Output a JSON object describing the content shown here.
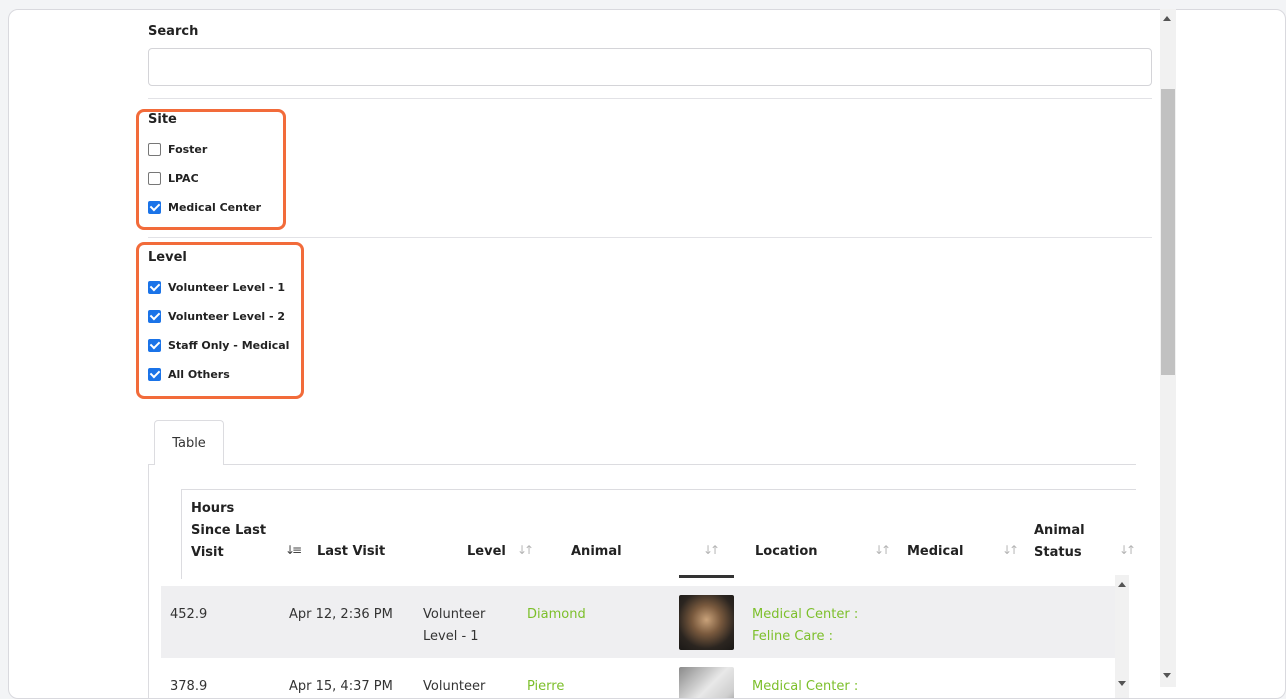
{
  "search": {
    "label": "Search",
    "value": "",
    "placeholder": ""
  },
  "site": {
    "label": "Site",
    "options": [
      {
        "label": "Foster",
        "checked": false
      },
      {
        "label": "LPAC",
        "checked": false
      },
      {
        "label": "Medical Center",
        "checked": true
      }
    ]
  },
  "level": {
    "label": "Level",
    "options": [
      {
        "label": "Volunteer Level - 1",
        "checked": true
      },
      {
        "label": "Volunteer Level - 2",
        "checked": true
      },
      {
        "label": "Staff Only - Medical",
        "checked": true
      },
      {
        "label": "All Others",
        "checked": true
      }
    ]
  },
  "tabs": [
    {
      "label": "Table",
      "active": true
    }
  ],
  "table": {
    "columns": [
      {
        "line1": "Hours",
        "line2": "Since Last",
        "line3": "Visit"
      },
      {
        "label": "Last Visit"
      },
      {
        "label": "Level"
      },
      {
        "label": "Animal"
      },
      {
        "label": "Location"
      },
      {
        "label": "Medical"
      },
      {
        "line1": "Animal",
        "line2": "Status"
      }
    ],
    "rows": [
      {
        "hours": "452.9",
        "last_visit": "Apr 12, 2:36 PM",
        "level_line1": "Volunteer",
        "level_line2": "Level - 1",
        "animal": "Diamond",
        "location_line1": "Medical Center :",
        "location_line2": "Feline Care :"
      },
      {
        "hours": "378.9",
        "last_visit": "Apr 15, 4:37 PM",
        "level_line1": "Volunteer",
        "level_line2": "",
        "animal": "Pierre",
        "location_line1": "Medical Center :",
        "location_line2": ""
      }
    ]
  },
  "colors": {
    "highlight": "#f26b3a",
    "link": "#7cbf2a",
    "checkbox": "#1a73e8"
  }
}
